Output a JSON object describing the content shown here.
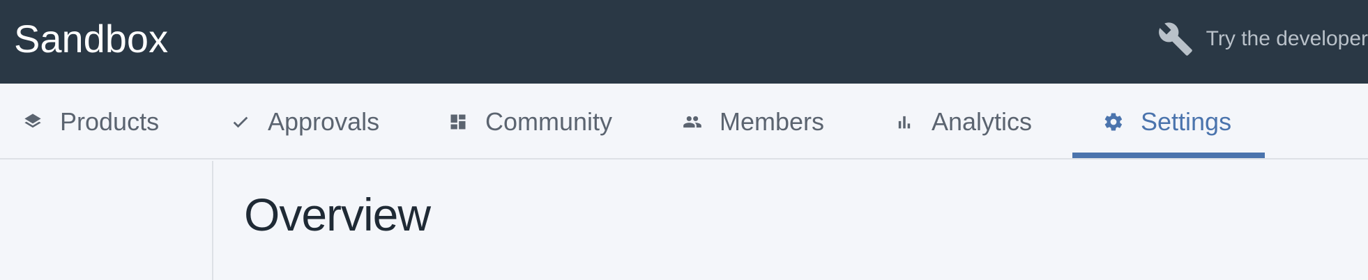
{
  "header": {
    "app_title": "Sandbox",
    "developer_link": "Try the developer",
    "icon": "wrench-icon"
  },
  "tabs": [
    {
      "label": "Products",
      "icon": "layers-icon",
      "active": false
    },
    {
      "label": "Approvals",
      "icon": "checkmark-icon",
      "active": false
    },
    {
      "label": "Community",
      "icon": "dashboard-icon",
      "active": false
    },
    {
      "label": "Members",
      "icon": "people-icon",
      "active": false
    },
    {
      "label": "Analytics",
      "icon": "bar-chart-icon",
      "active": false
    },
    {
      "label": "Settings",
      "icon": "gear-icon",
      "active": true
    }
  ],
  "main": {
    "title": "Overview"
  },
  "colors": {
    "topbar": "#2a3845",
    "accent": "#4b74ad",
    "background": "#f4f6fa",
    "tab_text": "#5b6470"
  }
}
